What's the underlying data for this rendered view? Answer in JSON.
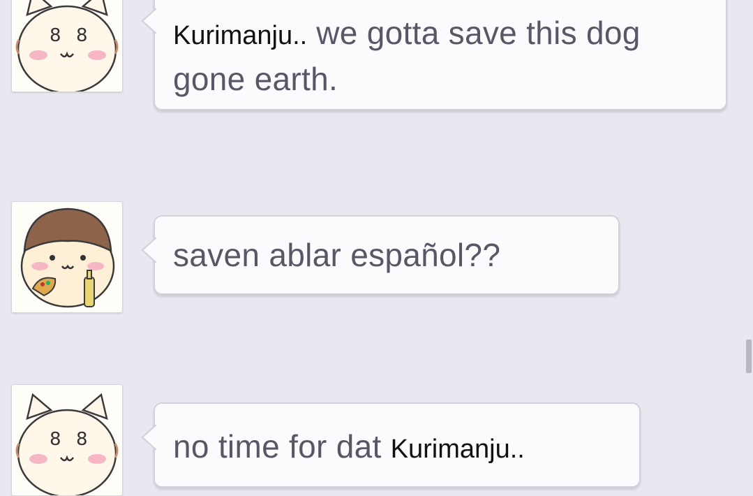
{
  "colors": {
    "background": "#e9e8f1",
    "bubble": "#fbfbfd",
    "bubble_border": "#d2d1da",
    "message_text": "#595765",
    "name_text": "#111111"
  },
  "messages": [
    {
      "avatar_icon": "cat-mascot-icon",
      "name_segment": "Kurimanju..",
      "text_after": " we gotta save this dog gone earth."
    },
    {
      "avatar_icon": "bald-mascot-icon",
      "text": "saven ablar español??"
    },
    {
      "avatar_icon": "cat-mascot-icon",
      "text_before": "no time for dat ",
      "name_segment": "Kurimanju.."
    }
  ]
}
